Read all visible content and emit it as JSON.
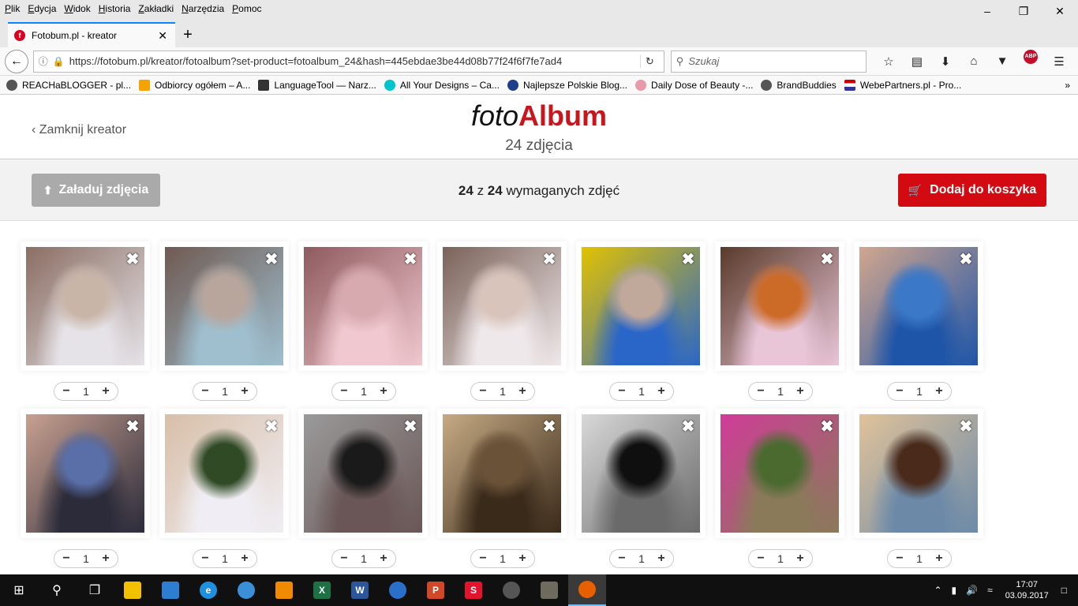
{
  "browser": {
    "menu": [
      "Plik",
      "Edycja",
      "Widok",
      "Historia",
      "Zakładki",
      "Narzędzia",
      "Pomoc"
    ],
    "tab_title": "Fotobum.pl - kreator",
    "url": "https://fotobum.pl/kreator/fotoalbum?set-product=fotoalbum_24&hash=445ebdae3be44d08b77f24f6f7fe7ad4",
    "search_placeholder": "Szukaj",
    "bookmarks": [
      "REACHaBLOGGER - pl...",
      "Odbiorcy ogółem – A...",
      "LanguageTool — Narz...",
      "All Your Designs – Ca...",
      "Najlepsze Polskie Blog...",
      "Daily Dose of Beauty -...",
      "BrandBuddies",
      "WebePartners.pl - Pro..."
    ]
  },
  "header": {
    "close_label": "Zamknij kreator",
    "brand_part1": "foto",
    "brand_part2": "Album",
    "subtitle": "24 zdjęcia"
  },
  "actions": {
    "upload_label": "Załaduj zdjęcia",
    "count_current": "24",
    "count_sep": "z",
    "count_required": "24",
    "count_suffix": "wymaganych zdjęć",
    "cart_label": "Dodaj do koszyka"
  },
  "photos": [
    {
      "qty": "1",
      "colors": [
        "#c9b5a8",
        "#8a6e63",
        "#e6e3e8"
      ]
    },
    {
      "qty": "1",
      "colors": [
        "#b8a59c",
        "#6f5a52",
        "#9fbfcf"
      ]
    },
    {
      "qty": "1",
      "colors": [
        "#d7aab0",
        "#8e5a5e",
        "#f0c8cf"
      ]
    },
    {
      "qty": "1",
      "colors": [
        "#d8c4bb",
        "#7a6259",
        "#efe8ea"
      ]
    },
    {
      "qty": "1",
      "colors": [
        "#c0a89a",
        "#e2c200",
        "#2a66c8"
      ]
    },
    {
      "qty": "1",
      "colors": [
        "#cc6a28",
        "#5a3a2a",
        "#e8c6d8"
      ]
    },
    {
      "qty": "1",
      "colors": [
        "#3b79c8",
        "#d2a68e",
        "#1e55a8"
      ]
    },
    {
      "qty": "1",
      "colors": [
        "#5a6fa8",
        "#c8a090",
        "#2b2b3a"
      ]
    },
    {
      "qty": "1",
      "colors": [
        "#2f4a24",
        "#d8bfa8",
        "#f0eef4"
      ]
    },
    {
      "qty": "1",
      "colors": [
        "#1a1a1a",
        "#9a9a9a",
        "#6a5656"
      ]
    },
    {
      "qty": "1",
      "colors": [
        "#6a5238",
        "#c6aa84",
        "#3a2a1a"
      ]
    },
    {
      "qty": "1",
      "colors": [
        "#0f0f0f",
        "#d8d8d8",
        "#6a6a6a"
      ]
    },
    {
      "qty": "1",
      "colors": [
        "#4a6a30",
        "#d03c98",
        "#8a7a5a"
      ]
    },
    {
      "qty": "1",
      "colors": [
        "#4a2a1a",
        "#e0c29a",
        "#6c8aa8"
      ]
    }
  ],
  "taskbar": {
    "time": "17:07",
    "date": "03.09.2017"
  }
}
